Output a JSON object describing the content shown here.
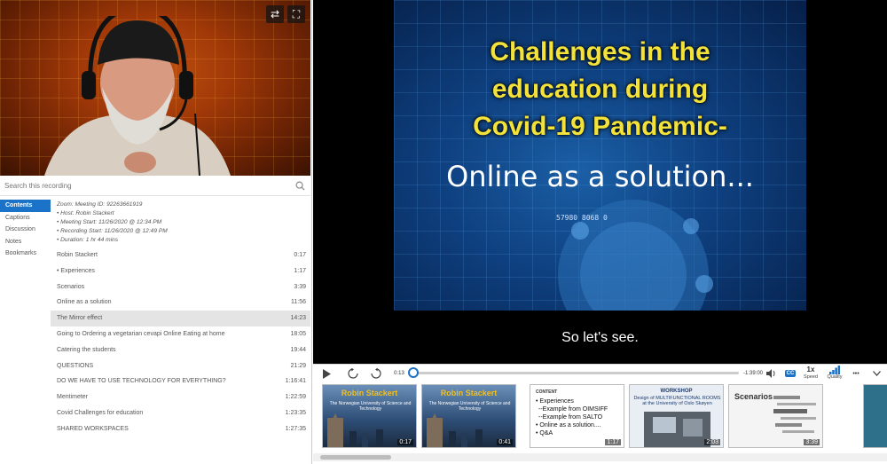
{
  "search": {
    "placeholder": "Search this recording"
  },
  "nav": [
    {
      "label": "Contents",
      "active": true
    },
    {
      "label": "Captions"
    },
    {
      "label": "Discussion"
    },
    {
      "label": "Notes"
    },
    {
      "label": "Bookmarks"
    }
  ],
  "meta": [
    "Zoom: Meeting ID: 92263661919",
    "• Host: Robin Stackert",
    "• Meeting Start: 11/26/2020 @ 12:34 PM",
    "• Recording Start: 11/26/2020 @ 12:49 PM",
    "• Duration: 1 hr 44 mins"
  ],
  "toc": [
    {
      "title": "Robin Stackert",
      "time": "0:17"
    },
    {
      "title": "• Experiences",
      "time": "1:17"
    },
    {
      "title": "Scenarios",
      "time": "3:39"
    },
    {
      "title": "Online as a solution",
      "time": "11:56"
    },
    {
      "title": "The Mirror effect",
      "time": "14:23",
      "active": true
    },
    {
      "title": "Going to Ordering a vegetarian cevapi Online Eating at home",
      "time": "18:05"
    },
    {
      "title": "Catering the students",
      "time": "19:44"
    },
    {
      "title": "QUESTIONS",
      "time": "21:29"
    },
    {
      "title": "DO WE HAVE TO USE TECHNOLOGY FOR EVERYTHING?",
      "time": "1:16:41"
    },
    {
      "title": "Mentimeter",
      "time": "1:22:59"
    },
    {
      "title": "Covid Challenges for education",
      "time": "1:23:35"
    },
    {
      "title": "SHARED WORKSPACES",
      "time": "1:27:35"
    }
  ],
  "slide": {
    "title_line1": "Challenges in the",
    "title_line2": "education during",
    "title_line3": "Covid-19 Pandemic-",
    "subtitle": "Online as a solution...",
    "numbers": "57980 8068 0"
  },
  "caption": "So let's see.",
  "controls": {
    "elapsed": "0:13",
    "remaining": "-1:39:00",
    "cc": "CC",
    "speed_value": "1x",
    "speed_label": "Speed",
    "quality_label": "Quality",
    "more": "•••"
  },
  "thumbs": [
    {
      "title": "Robin Stackert",
      "sub": "The Norwegian University of Science and Technology",
      "time": "0:17"
    },
    {
      "title": "Robin Stackert",
      "sub": "The Norwegian University of Science and Technology",
      "time": "0:41"
    },
    {
      "title": "CONTENT",
      "bullets": [
        "• Experiences",
        "--Example from OIMSIFF",
        "--Example from SALTO",
        "• Online as a solution....",
        "• Q&A"
      ],
      "time": "1:17"
    },
    {
      "title": "WORKSHOP",
      "sub": "Design of MULTIFUNCTIONAL ROOMS at the University of Oslo Skøyen",
      "time": "2:03"
    },
    {
      "title": "Scenarios",
      "time": "3:39"
    }
  ],
  "colors": {
    "accent": "#1a73c8",
    "slide_title": "#f3e23a"
  }
}
